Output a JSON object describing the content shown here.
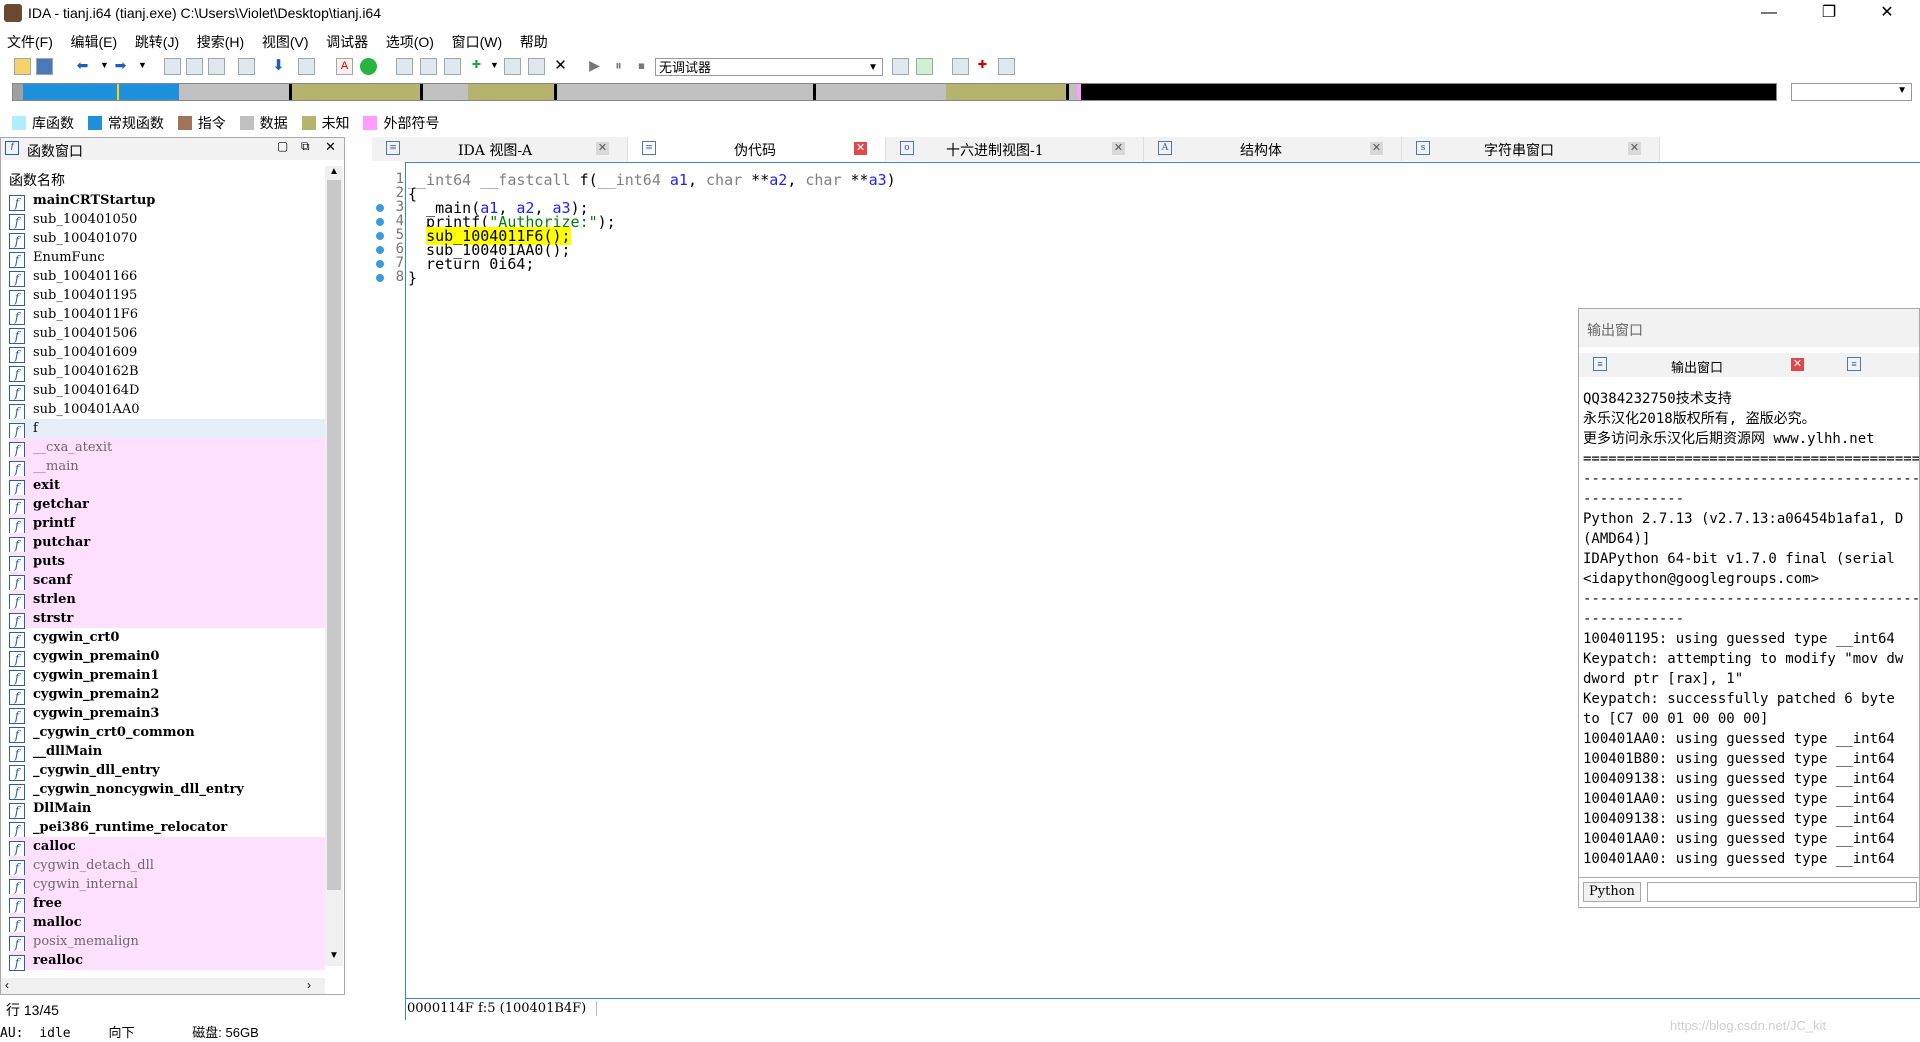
{
  "window": {
    "title": "IDA - tianj.i64 (tianj.exe) C:\\Users\\Violet\\Desktop\\tianj.i64",
    "minimize": "—",
    "maximize": "❐",
    "close": "✕"
  },
  "menu": [
    "文件(F)",
    "编辑(E)",
    "跳转(J)",
    "搜索(H)",
    "视图(V)",
    "调试器",
    "选项(O)",
    "窗口(W)",
    "帮助"
  ],
  "toolbar": {
    "debugger_select": "无调试器"
  },
  "legend": [
    {
      "label": "库函数",
      "color": "#aeeeff"
    },
    {
      "label": "常规函数",
      "color": "#1e90dc"
    },
    {
      "label": "指令",
      "color": "#a0745a"
    },
    {
      "label": "数据",
      "color": "#c0c0c0"
    },
    {
      "label": "未知",
      "color": "#b4b46e"
    },
    {
      "label": "外部符号",
      "color": "#ff9cff"
    }
  ],
  "functions_panel": {
    "title": "函数窗口",
    "column_header": "函数名称",
    "items": [
      {
        "name": "mainCRTStartup",
        "style": "bold"
      },
      {
        "name": "sub_100401050",
        "style": "normal"
      },
      {
        "name": "sub_100401070",
        "style": "normal"
      },
      {
        "name": "EnumFunc",
        "style": "normal"
      },
      {
        "name": "sub_100401166",
        "style": "normal"
      },
      {
        "name": "sub_100401195",
        "style": "normal"
      },
      {
        "name": "sub_1004011F6",
        "style": "normal"
      },
      {
        "name": "sub_100401506",
        "style": "normal"
      },
      {
        "name": "sub_100401609",
        "style": "normal"
      },
      {
        "name": "sub_10040162B",
        "style": "normal"
      },
      {
        "name": "sub_10040164D",
        "style": "normal"
      },
      {
        "name": "sub_100401AA0",
        "style": "normal"
      },
      {
        "name": "f",
        "style": "selected"
      },
      {
        "name": "__cxa_atexit",
        "style": "lib"
      },
      {
        "name": "__main",
        "style": "lib"
      },
      {
        "name": "exit",
        "style": "libbold"
      },
      {
        "name": "getchar",
        "style": "libbold"
      },
      {
        "name": "printf",
        "style": "libbold"
      },
      {
        "name": "putchar",
        "style": "libbold"
      },
      {
        "name": "puts",
        "style": "libbold"
      },
      {
        "name": "scanf",
        "style": "libbold"
      },
      {
        "name": "strlen",
        "style": "libbold"
      },
      {
        "name": "strstr",
        "style": "libbold"
      },
      {
        "name": "cygwin_crt0",
        "style": "bold"
      },
      {
        "name": "cygwin_premain0",
        "style": "bold"
      },
      {
        "name": "cygwin_premain1",
        "style": "bold"
      },
      {
        "name": "cygwin_premain2",
        "style": "bold"
      },
      {
        "name": "cygwin_premain3",
        "style": "bold"
      },
      {
        "name": "_cygwin_crt0_common",
        "style": "bold"
      },
      {
        "name": "__dllMain",
        "style": "bold"
      },
      {
        "name": "_cygwin_dll_entry",
        "style": "bold"
      },
      {
        "name": "_cygwin_noncygwin_dll_entry",
        "style": "bold"
      },
      {
        "name": "DllMain",
        "style": "bold"
      },
      {
        "name": "_pei386_runtime_relocator",
        "style": "bold"
      },
      {
        "name": "calloc",
        "style": "libbold"
      },
      {
        "name": "cygwin_detach_dll",
        "style": "lib"
      },
      {
        "name": "cygwin_internal",
        "style": "lib"
      },
      {
        "name": "free",
        "style": "libbold"
      },
      {
        "name": "malloc",
        "style": "libbold"
      },
      {
        "name": "posix_memalign",
        "style": "lib"
      },
      {
        "name": "realloc",
        "style": "libbold"
      }
    ],
    "row_status": "行 13/45"
  },
  "status_bar": {
    "au": "AU:",
    "state": "idle",
    "direction": "向下",
    "disk": "磁盘: 56GB"
  },
  "tabs": [
    {
      "label": "IDA 视图-A",
      "active": false
    },
    {
      "label": "伪代码",
      "active": true
    },
    {
      "label": "十六进制视图-1",
      "active": false
    },
    {
      "label": "结构体",
      "active": false
    },
    {
      "label": "字符串窗口",
      "active": false
    }
  ],
  "pseudocode": {
    "lines": [
      {
        "n": "1",
        "text": "__int64 __fastcall f(__int64 a1, char **a2, char **a3)",
        "dot": false
      },
      {
        "n": "2",
        "text": "{",
        "dot": false
      },
      {
        "n": "3",
        "text": "  _main(a1, a2, a3);",
        "dot": true
      },
      {
        "n": "4",
        "text": "  printf(\"Authorize:\");",
        "dot": true
      },
      {
        "n": "5",
        "text": "  sub_1004011F6();",
        "dot": true
      },
      {
        "n": "6",
        "text": "  sub_100401AA0();",
        "dot": true
      },
      {
        "n": "7",
        "text": "  return 0i64;",
        "dot": true
      },
      {
        "n": "8",
        "text": "}",
        "dot": true
      }
    ],
    "status": "0000114F f:5 (100401B4F)"
  },
  "output_window": {
    "title": "输出窗口",
    "tab_label": "输出窗口",
    "lines": [
      "QQ384232750技术支持",
      "永乐汉化2018版权所有, 盗版必究。",
      "更多访问永乐汉化后期资源网 www.ylhh.net",
      "==========================================",
      "------------------------------------------",
      "------------",
      "Python 2.7.13 (v2.7.13:a06454b1afa1, D",
      "(AMD64)]",
      "IDAPython 64-bit v1.7.0 final (serial",
      "<idapython@googlegroups.com>",
      "------------------------------------------",
      "------------",
      "100401195: using guessed type __int64",
      "Keypatch: attempting to modify \"mov dw",
      "dword ptr [rax], 1\"",
      "Keypatch: successfully patched 6 byte",
      "to [C7 00 01 00 00 00]",
      "100401AA0: using guessed type __int64",
      "100401B80: using guessed type __int64",
      "100409138: using guessed type __int64",
      "100401AA0: using guessed type __int64",
      "100409138: using guessed type __int64",
      "100401AA0: using guessed type __int64",
      "100401AA0: using guessed type __int64"
    ],
    "python_button": "Python"
  },
  "watermark": "https://blog.csdn.net/JC_kit"
}
